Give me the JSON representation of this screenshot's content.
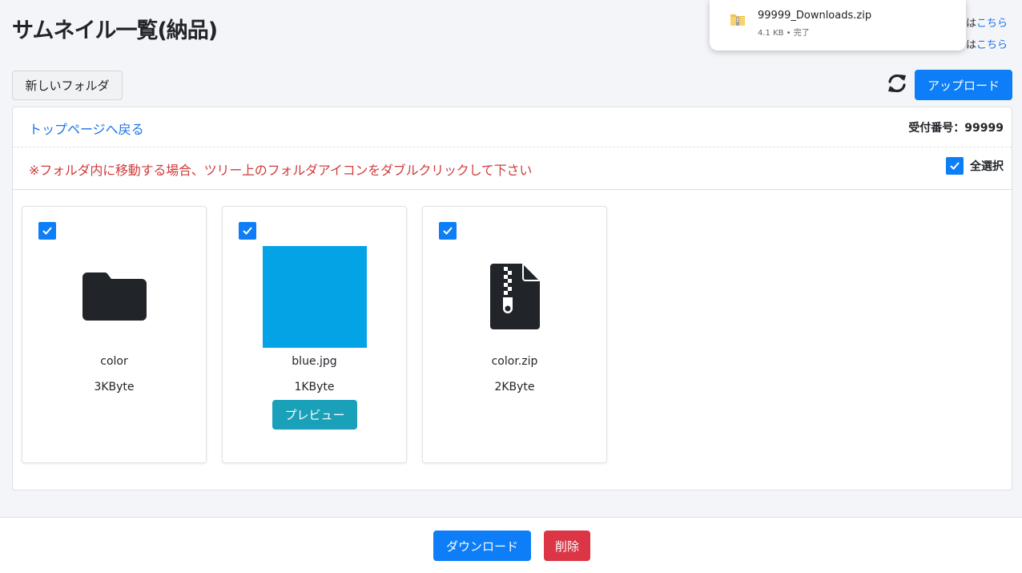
{
  "header": {
    "title": "サムネイル一覧(納品)",
    "link_rows": [
      {
        "prefix": "は",
        "link": "こちら"
      },
      {
        "prefix": "は",
        "link": "こちら"
      }
    ]
  },
  "download_popup": {
    "filename": "99999_Downloads.zip",
    "meta": "4.1 KB • 完了"
  },
  "toolbar": {
    "new_folder_label": "新しいフォルダ",
    "upload_label": "アップロード"
  },
  "panel": {
    "back_link": "トップページへ戻る",
    "receipt_number": "受付番号：99999",
    "notice": "※フォルダ内に移動する場合、ツリー上のフォルダアイコンをダブルクリックして下さい",
    "select_all_label": "全選択"
  },
  "files": [
    {
      "name": "color",
      "size": "3KByte",
      "type": "folder-icon",
      "checked": true
    },
    {
      "name": "blue.jpg",
      "size": "1KByte",
      "type": "image",
      "thumb_color": "#03a3e6",
      "checked": true,
      "preview_label": "プレビュー"
    },
    {
      "name": "color.zip",
      "size": "2KByte",
      "type": "zip-file-icon",
      "checked": true
    }
  ],
  "footer": {
    "download_label": "ダウンロード",
    "delete_label": "削除"
  },
  "colors": {
    "primary": "#0d7ef8",
    "info": "#1aa0b8",
    "danger": "#dc3545",
    "notice_text": "#d23b3b",
    "link": "#1a73e8"
  }
}
